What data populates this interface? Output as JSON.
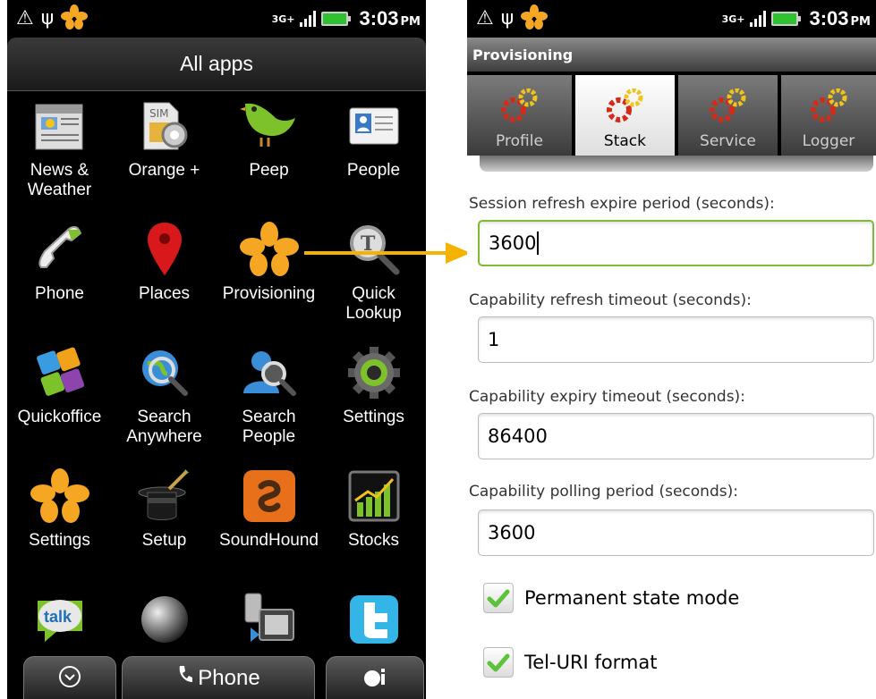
{
  "status": {
    "network": "3G+",
    "time": "3:03",
    "ampm": "PM"
  },
  "left": {
    "header": "All apps",
    "apps": [
      {
        "label": "News &\nWeather",
        "icon": "news-weather-icon"
      },
      {
        "label": "Orange +",
        "icon": "sim-settings-icon"
      },
      {
        "label": "Peep",
        "icon": "bird-icon"
      },
      {
        "label": "People",
        "icon": "contact-card-icon"
      },
      {
        "label": "Phone",
        "icon": "phone-handset-icon"
      },
      {
        "label": "Places",
        "icon": "map-pin-icon"
      },
      {
        "label": "Provisioning",
        "icon": "orange-flower-icon"
      },
      {
        "label": "Quick\nLookup",
        "icon": "magnifier-icon"
      },
      {
        "label": "Quickoffice",
        "icon": "office-tiles-icon"
      },
      {
        "label": "Search\nAnywhere",
        "icon": "globe-search-icon"
      },
      {
        "label": "Search\nPeople",
        "icon": "person-search-icon"
      },
      {
        "label": "Settings",
        "icon": "gear-icon"
      },
      {
        "label": "Settings",
        "icon": "orange-flower-icon"
      },
      {
        "label": "Setup",
        "icon": "magic-hat-icon"
      },
      {
        "label": "SoundHound",
        "icon": "soundhound-icon"
      },
      {
        "label": "Stocks",
        "icon": "stocks-chart-icon"
      },
      {
        "label": "",
        "icon": "talk-bubble-icon"
      },
      {
        "label": "",
        "icon": "sphere-icon"
      },
      {
        "label": "",
        "icon": "phone-transfer-icon"
      },
      {
        "label": "",
        "icon": "twitter-icon"
      }
    ],
    "dock": {
      "phone_label": "Phone"
    }
  },
  "right": {
    "title": "Provisioning",
    "tabs": [
      {
        "label": "Profile",
        "active": false
      },
      {
        "label": "Stack",
        "active": true
      },
      {
        "label": "Service",
        "active": false
      },
      {
        "label": "Logger",
        "active": false
      }
    ],
    "fields": [
      {
        "label": "Session refresh expire period (seconds):",
        "value": "3600",
        "focused": true
      },
      {
        "label": "Capability refresh timeout (seconds):",
        "value": "1",
        "focused": false
      },
      {
        "label": "Capability expiry timeout (seconds):",
        "value": "86400",
        "focused": false
      },
      {
        "label": "Capability polling period (seconds):",
        "value": "3600",
        "focused": false
      }
    ],
    "checkboxes": [
      {
        "label": "Permanent state mode",
        "checked": true
      },
      {
        "label": "Tel-URI format",
        "checked": true
      }
    ]
  },
  "colors": {
    "accent_orange": "#f5a623",
    "focus_green": "#7fb93a",
    "check_green": "#5cc23a",
    "gear_red": "#d42a1a",
    "gear_yellow": "#f0c419"
  }
}
